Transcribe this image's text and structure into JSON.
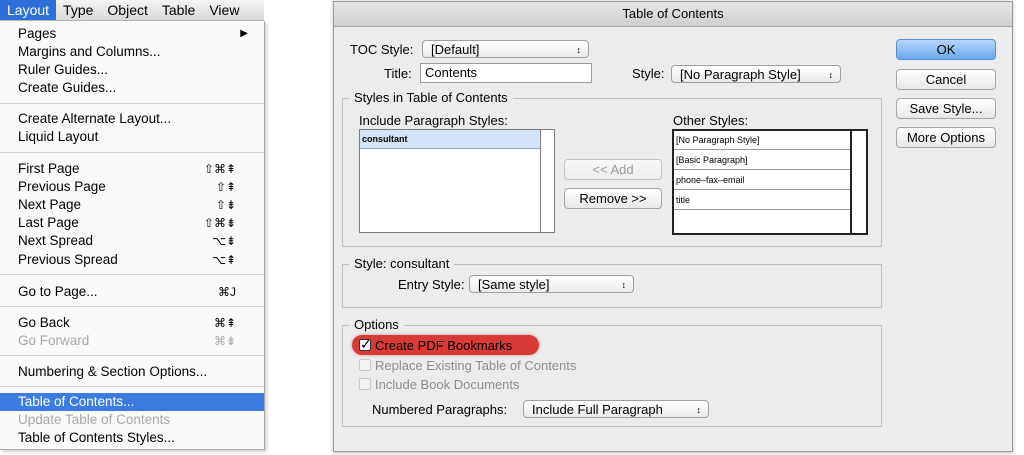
{
  "menubar": {
    "items": [
      "Layout",
      "Type",
      "Object",
      "Table",
      "View"
    ],
    "active_index": 0
  },
  "layout_menu": {
    "items": [
      {
        "label": "Pages",
        "shortcut": "",
        "submenu": true
      },
      {
        "label": "Margins and Columns...",
        "shortcut": ""
      },
      {
        "label": "Ruler Guides...",
        "shortcut": ""
      },
      {
        "label": "Create Guides...",
        "shortcut": ""
      },
      {
        "label": "Create Alternate Layout...",
        "shortcut": ""
      },
      {
        "label": "Liquid Layout",
        "shortcut": ""
      },
      {
        "label": "First Page",
        "shortcut": "⇧⌘⇞"
      },
      {
        "label": "Previous Page",
        "shortcut": "⇧⇞"
      },
      {
        "label": "Next Page",
        "shortcut": "⇧⇟"
      },
      {
        "label": "Last Page",
        "shortcut": "⇧⌘⇟"
      },
      {
        "label": "Next Spread",
        "shortcut": "⌥⇟"
      },
      {
        "label": "Previous Spread",
        "shortcut": "⌥⇞"
      },
      {
        "label": "Go to Page...",
        "shortcut": "⌘J"
      },
      {
        "label": "Go Back",
        "shortcut": "⌘⇞"
      },
      {
        "label": "Go Forward",
        "shortcut": "⌘⇟",
        "disabled": true
      },
      {
        "label": "Numbering & Section Options...",
        "shortcut": ""
      },
      {
        "label": "Table of Contents...",
        "shortcut": "",
        "highlighted": true
      },
      {
        "label": "Update Table of Contents",
        "shortcut": "",
        "disabled": true
      },
      {
        "label": "Table of Contents Styles...",
        "shortcut": ""
      }
    ]
  },
  "dialog": {
    "title": "Table of Contents",
    "toc_style_label": "TOC Style:",
    "toc_style_value": "[Default]",
    "title_label": "Title:",
    "title_value": "Contents",
    "style_label": "Style:",
    "style_value": "[No Paragraph Style]",
    "buttons": {
      "ok": "OK",
      "cancel": "Cancel",
      "save_style": "Save Style...",
      "more_options": "More Options"
    },
    "styles_group": {
      "title": "Styles in Table of Contents",
      "include_label": "Include Paragraph Styles:",
      "include_items": [
        "consultant"
      ],
      "add_button": "<< Add",
      "remove_button": "Remove >>",
      "other_label": "Other Styles:",
      "other_items": [
        "[No Paragraph Style]",
        "[Basic Paragraph]",
        "phone–fax–email",
        "title"
      ]
    },
    "style_group": {
      "title": "Style: consultant",
      "entry_style_label": "Entry Style:",
      "entry_style_value": "[Same style]"
    },
    "options_group": {
      "title": "Options",
      "create_pdf_bookmarks": "Create PDF Bookmarks",
      "replace_existing": "Replace Existing Table of Contents",
      "include_book": "Include Book Documents",
      "numbered_paragraphs_label": "Numbered Paragraphs:",
      "numbered_paragraphs_value": "Include Full Paragraph"
    },
    "colors": {
      "default_button": "#6aa7ef",
      "highlight_annotation": "#d83b37"
    }
  }
}
